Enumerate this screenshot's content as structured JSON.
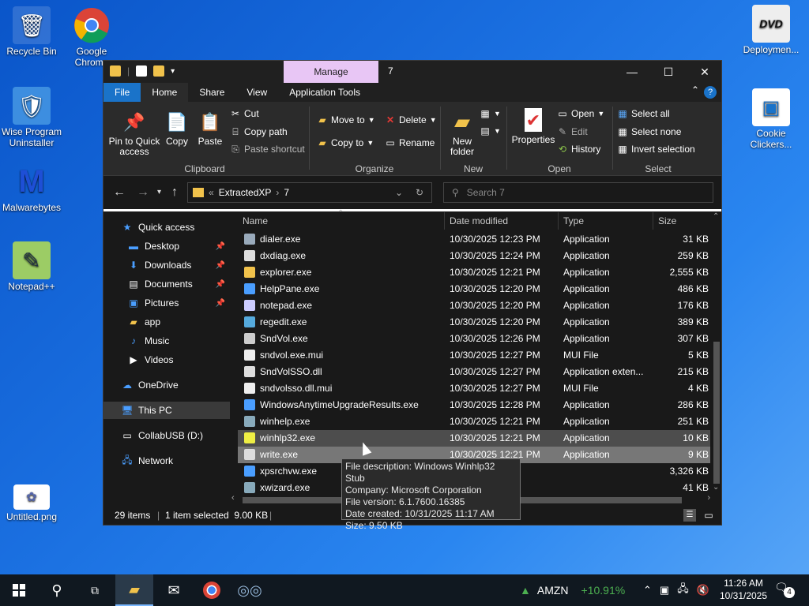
{
  "desktop": {
    "icons": [
      {
        "label": "Recycle Bin"
      },
      {
        "label": "Google Chrome"
      },
      {
        "label": "Wise Program Uninstaller"
      },
      {
        "label": "Malwarebytes"
      },
      {
        "label": "Notepad++"
      },
      {
        "label": "Untitled.png"
      },
      {
        "label": "Deploymen..."
      },
      {
        "label": "Cookie Clickers..."
      }
    ]
  },
  "window": {
    "manage_tab": "Manage",
    "title": "7",
    "controls": {
      "minimize": "—",
      "maximize": "☐",
      "close": "✕"
    }
  },
  "ribbon_tabs": [
    "File",
    "Home",
    "Share",
    "View",
    "Application Tools"
  ],
  "ribbon": {
    "clipboard": {
      "label": "Clipboard",
      "pin": "Pin to Quick access",
      "copy": "Copy",
      "paste": "Paste",
      "cut": "Cut",
      "copy_path": "Copy path",
      "paste_shortcut": "Paste shortcut"
    },
    "organize": {
      "label": "Organize",
      "move_to": "Move to",
      "copy_to": "Copy to",
      "delete": "Delete",
      "rename": "Rename"
    },
    "new": {
      "label": "New",
      "new_folder": "New folder"
    },
    "open": {
      "label": "Open",
      "properties": "Properties",
      "open": "Open",
      "edit": "Edit",
      "history": "History"
    },
    "select": {
      "label": "Select",
      "select_all": "Select all",
      "select_none": "Select none",
      "invert": "Invert selection"
    }
  },
  "address": {
    "path": [
      "ExtractedXP",
      "7"
    ],
    "prefix": "«",
    "search_placeholder": "Search 7"
  },
  "nav": {
    "items": [
      {
        "label": "Quick access"
      },
      {
        "label": "Desktop"
      },
      {
        "label": "Downloads"
      },
      {
        "label": "Documents"
      },
      {
        "label": "Pictures"
      },
      {
        "label": "app"
      },
      {
        "label": "Music"
      },
      {
        "label": "Videos"
      },
      {
        "label": "OneDrive"
      },
      {
        "label": "This PC"
      },
      {
        "label": "CollabUSB (D:)"
      },
      {
        "label": "Network"
      }
    ]
  },
  "columns": [
    "Name",
    "Date modified",
    "Type",
    "Size"
  ],
  "files": [
    {
      "name": "dialer.exe",
      "date": "10/30/2025 12:23 PM",
      "type": "Application",
      "size": "31 KB"
    },
    {
      "name": "dxdiag.exe",
      "date": "10/30/2025 12:24 PM",
      "type": "Application",
      "size": "259 KB"
    },
    {
      "name": "explorer.exe",
      "date": "10/30/2025 12:21 PM",
      "type": "Application",
      "size": "2,555 KB"
    },
    {
      "name": "HelpPane.exe",
      "date": "10/30/2025 12:20 PM",
      "type": "Application",
      "size": "486 KB"
    },
    {
      "name": "notepad.exe",
      "date": "10/30/2025 12:20 PM",
      "type": "Application",
      "size": "176 KB"
    },
    {
      "name": "regedit.exe",
      "date": "10/30/2025 12:20 PM",
      "type": "Application",
      "size": "389 KB"
    },
    {
      "name": "SndVol.exe",
      "date": "10/30/2025 12:26 PM",
      "type": "Application",
      "size": "307 KB"
    },
    {
      "name": "sndvol.exe.mui",
      "date": "10/30/2025 12:27 PM",
      "type": "MUI File",
      "size": "5 KB"
    },
    {
      "name": "SndVolSSO.dll",
      "date": "10/30/2025 12:27 PM",
      "type": "Application exten...",
      "size": "215 KB"
    },
    {
      "name": "sndvolsso.dll.mui",
      "date": "10/30/2025 12:27 PM",
      "type": "MUI File",
      "size": "4 KB"
    },
    {
      "name": "WindowsAnytimeUpgradeResults.exe",
      "date": "10/30/2025 12:28 PM",
      "type": "Application",
      "size": "286 KB"
    },
    {
      "name": "winhelp.exe",
      "date": "10/30/2025 12:21 PM",
      "type": "Application",
      "size": "251 KB"
    },
    {
      "name": "winhlp32.exe",
      "date": "10/30/2025 12:21 PM",
      "type": "Application",
      "size": "10 KB"
    },
    {
      "name": "write.exe",
      "date": "10/30/2025 12:21 PM",
      "type": "Application",
      "size": "9 KB"
    },
    {
      "name": "xpsrchvw.exe",
      "date": "",
      "type": "",
      "size": "3,326 KB"
    },
    {
      "name": "xwizard.exe",
      "date": "",
      "type": "",
      "size": "41 KB"
    }
  ],
  "tooltip": {
    "line1": "File description: Windows Winhlp32 Stub",
    "line2": "Company: Microsoft Corporation",
    "line3": "File version: 6.1.7600.16385",
    "line4": "Date created: 10/31/2025 11:17 AM",
    "line5": "Size: 9.50 KB"
  },
  "status": {
    "items": "29 items",
    "selected": "1 item selected  9.00 KB"
  },
  "taskbar": {
    "ticker": "AMZN",
    "change": "+10.91%",
    "time": "11:26 AM",
    "date": "10/31/2025",
    "notifications": "4"
  }
}
